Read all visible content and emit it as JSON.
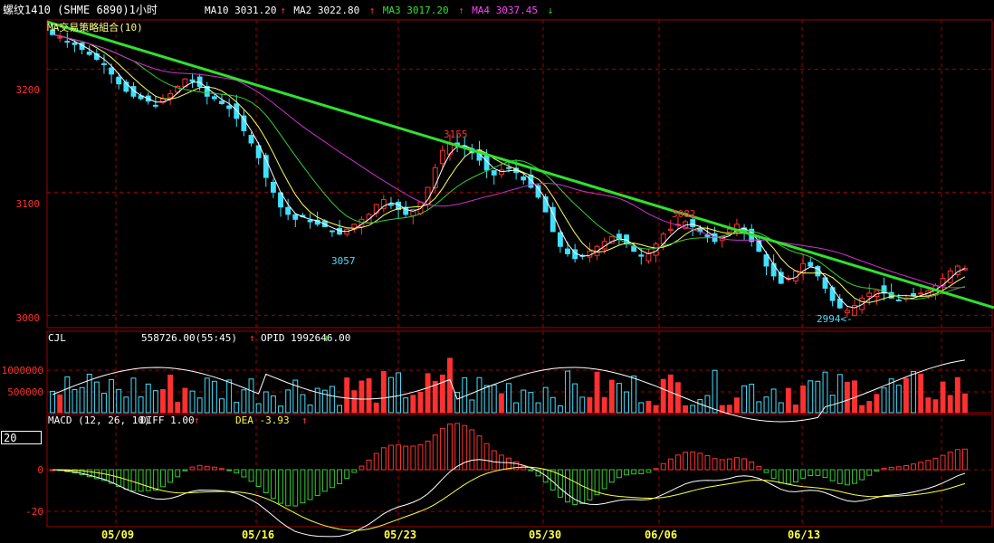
{
  "header": {
    "instrument": "螺纹1410 (SHME 6890)1小时",
    "indicator_title": "MA交易策略組合(10)",
    "ma_readouts": [
      {
        "text": "MA10 3031.20",
        "color": "#ffffff",
        "arrow": "↑",
        "arrow_color": "#ff3030"
      },
      {
        "text": "MA2  3022.80",
        "color": "#ffffff",
        "arrow": "↑",
        "arrow_color": "#ff3030"
      },
      {
        "text": "MA3  3017.20",
        "color": "#30e030",
        "arrow": "↑",
        "arrow_color": "#ff3030"
      },
      {
        "text": "MA4  3037.45",
        "color": "#ff40ff",
        "arrow": "↓",
        "arrow_color": "#30e030"
      }
    ]
  },
  "volume_panel": {
    "label": "CJL",
    "value_text": "558726.00(55:45)",
    "arrow": "↑",
    "opid_text": "OPID  1992646.00",
    "opid_arrow": "↓"
  },
  "macd_panel": {
    "label": "MACD (12, 26, 10)",
    "diff_text": "DIFF  1.00",
    "diff_arrow": "↑",
    "dea_text": "DEA  -3.93",
    "dea_arrow": "↑"
  },
  "period_input": {
    "value": "20"
  },
  "price_annotations": [
    "3155",
    "3057",
    "3082",
    "2994<-"
  ],
  "colors": {
    "up": "#ff3030",
    "down": "#40e0ff",
    "ma1": "#ffffff",
    "ma2": "#ffff60",
    "ma3": "#30d030",
    "ma4": "#d030d0",
    "trendline": "#30e030",
    "grid": "#a00000",
    "axis_text": "#ff3030"
  },
  "chart_data": [
    {
      "type": "candlestick",
      "title": "螺纹1410 (SHME 6890)1小时",
      "x_tick_labels": [
        "05/09",
        "05/16",
        "05/23",
        "05/30",
        "06/06",
        "06/13"
      ],
      "y_tick_labels": [
        "3200",
        "3100",
        "3000"
      ],
      "ylim": [
        2990,
        3240
      ],
      "grid": true,
      "approximate": true,
      "anchor_points": [
        {
          "label": "start",
          "close": 3225
        },
        {
          "label": "3057",
          "low": 3057
        },
        {
          "label": "3155",
          "high": 3155
        },
        {
          "label": "3082",
          "high": 3082
        },
        {
          "label": "2994<-",
          "low": 2994
        },
        {
          "label": "end",
          "close": 3038
        }
      ],
      "closes": [
        3228,
        3226,
        3222,
        3220,
        3216,
        3212,
        3208,
        3204,
        3196,
        3188,
        3182,
        3178,
        3176,
        3174,
        3170,
        3176,
        3180,
        3186,
        3192,
        3190,
        3186,
        3178,
        3176,
        3172,
        3168,
        3160,
        3150,
        3140,
        3128,
        3112,
        3100,
        3088,
        3082,
        3078,
        3080,
        3076,
        3074,
        3072,
        3068,
        3066,
        3070,
        3074,
        3078,
        3082,
        3090,
        3094,
        3090,
        3086,
        3082,
        3086,
        3092,
        3104,
        3120,
        3134,
        3140,
        3138,
        3136,
        3132,
        3126,
        3118,
        3114,
        3118,
        3120,
        3116,
        3110,
        3104,
        3096,
        3084,
        3068,
        3056,
        3050,
        3046,
        3048,
        3052,
        3056,
        3060,
        3064,
        3062,
        3058,
        3052,
        3048,
        3050,
        3058,
        3066,
        3070,
        3074,
        3076,
        3072,
        3068,
        3064,
        3060,
        3064,
        3070,
        3074,
        3068,
        3060,
        3052,
        3040,
        3032,
        3026,
        3030,
        3036,
        3042,
        3040,
        3032,
        3022,
        3012,
        3006,
        3004,
        3008,
        3014,
        3018,
        3020,
        3018,
        3014,
        3012,
        3014,
        3016,
        3018,
        3020,
        3024,
        3030,
        3036,
        3040,
        3038
      ]
    },
    {
      "type": "bar",
      "title": "CJL",
      "y_tick_labels": [
        "1000000",
        "500000"
      ],
      "ylim": [
        0,
        1250000
      ]
    },
    {
      "type": "bar",
      "title": "MACD (12, 26, 10)",
      "y_tick_labels": [
        "0",
        "-20"
      ],
      "ylim": [
        -25,
        15
      ]
    }
  ]
}
